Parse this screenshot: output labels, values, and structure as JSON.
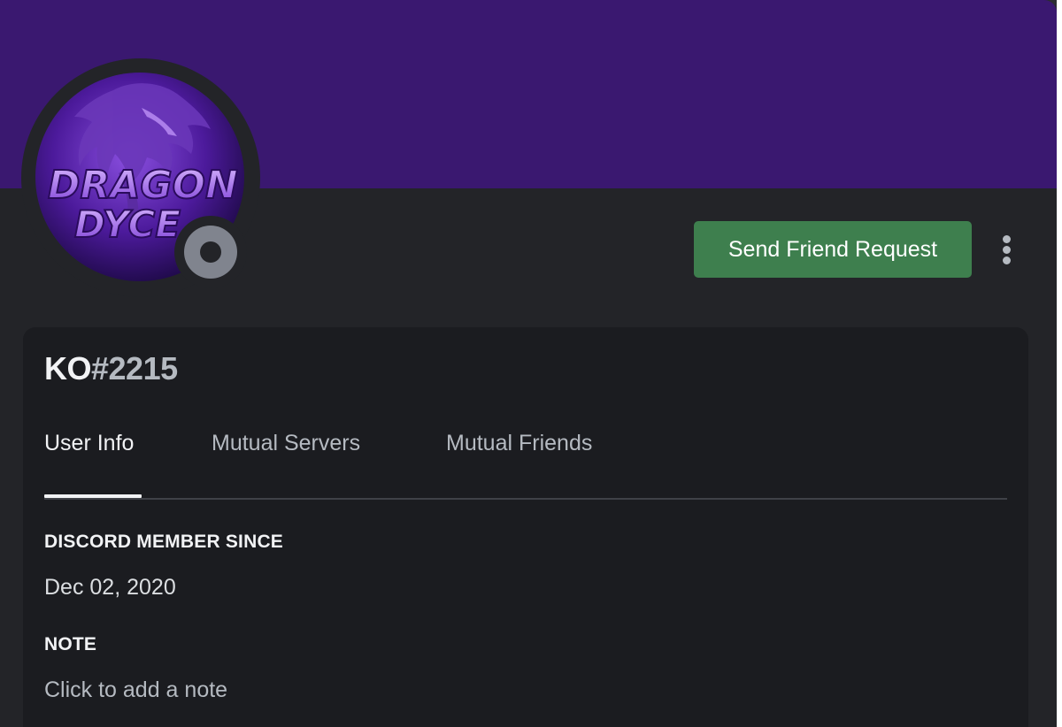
{
  "colors": {
    "banner": "#3a1870",
    "card_bg": "#232428",
    "panel_bg": "#1b1c20",
    "friend_button": "#3e7f4e",
    "status_offline": "#80848e"
  },
  "avatar": {
    "alt": "DRAGON DYCE avatar",
    "line1": "DRAGON",
    "line2": "DYCE"
  },
  "status": {
    "icon": "offline-status-icon"
  },
  "actions": {
    "friend_request_label": "Send Friend Request",
    "more_icon": "more-vertical-icon"
  },
  "user": {
    "name": "KO",
    "discriminator": "#2215"
  },
  "tabs": [
    {
      "label": "User Info",
      "active": true
    },
    {
      "label": "Mutual Servers",
      "active": false
    },
    {
      "label": "Mutual Friends",
      "active": false
    }
  ],
  "sections": {
    "member_since_heading": "DISCORD MEMBER SINCE",
    "member_since_value": "Dec 02, 2020",
    "note_heading": "NOTE",
    "note_placeholder": "Click to add a note"
  }
}
